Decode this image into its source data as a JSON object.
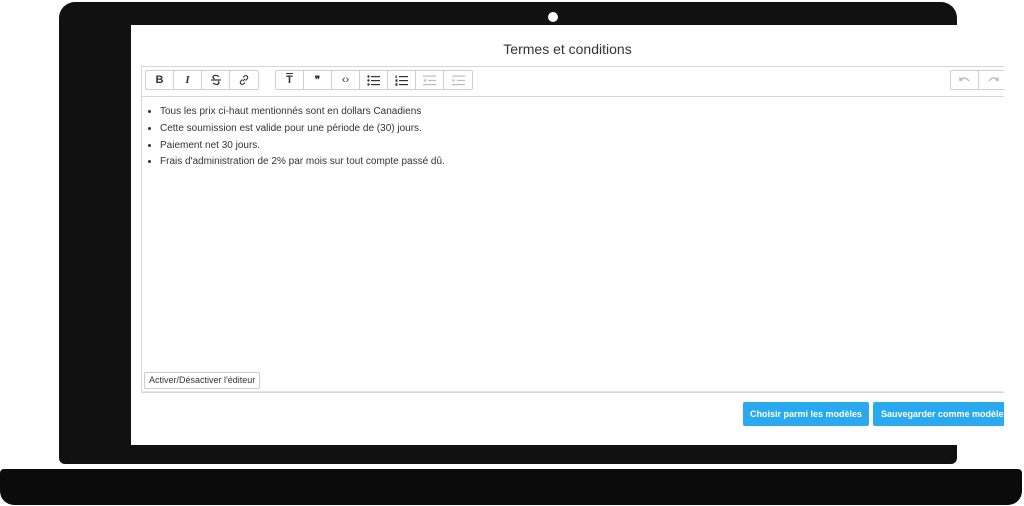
{
  "page": {
    "title": "Termes et conditions"
  },
  "toolbar": {
    "bold_label": "B",
    "italic_label": "I",
    "heading_label": "T",
    "quote_label": "❞",
    "code_label": "‹›",
    "icons": {
      "bold": "bold-icon",
      "italic": "italic-icon",
      "strikethrough": "strikethrough-icon",
      "link": "link-icon",
      "heading": "heading-icon",
      "quote": "quote-icon",
      "code": "code-icon",
      "bullet_list": "bullet-list-icon",
      "numbered_list": "numbered-list-icon",
      "outdent": "outdent-icon",
      "indent": "indent-icon",
      "undo": "undo-icon",
      "redo": "redo-icon"
    }
  },
  "content": {
    "items": [
      "Tous les prix ci-haut mentionnés sont en dollars Canadiens",
      "Cette soumission est valide pour une période de (30) jours.",
      "Paiement net 30 jours.",
      "Frais d'administration de 2% par mois sur tout compte passé dû."
    ]
  },
  "editor": {
    "toggle_label": "Activer/Désactiver l'éditeur"
  },
  "actions": {
    "choose_template": "Choisir parmi les modèles",
    "save_template": "Sauvegarder comme modèle"
  },
  "colors": {
    "button": "#29aaf0",
    "frame": "#111111"
  }
}
